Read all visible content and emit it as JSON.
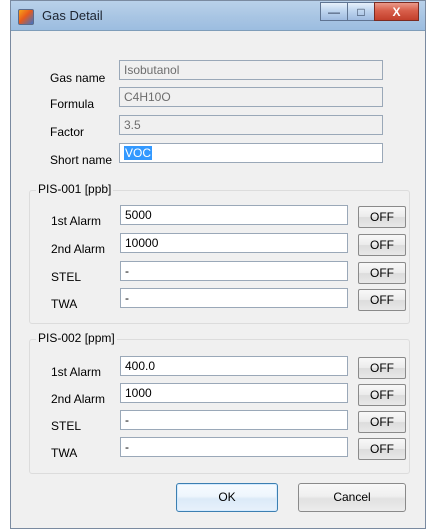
{
  "window": {
    "title": "Gas Detail",
    "background_glyph": "g"
  },
  "fields": {
    "gas_name": {
      "label": "Gas name",
      "value": "Isobutanol"
    },
    "formula": {
      "label": "Formula",
      "value": "C4H10O"
    },
    "factor": {
      "label": "Factor",
      "value": "3.5"
    },
    "short_name": {
      "label": "Short name",
      "value": "VOC"
    }
  },
  "groups": [
    {
      "title": "PIS-001  [ppb]",
      "rows": [
        {
          "label": "1st Alarm",
          "value": "5000",
          "button": "OFF"
        },
        {
          "label": "2nd Alarm",
          "value": "10000",
          "button": "OFF"
        },
        {
          "label": "STEL",
          "value": "-",
          "button": "OFF"
        },
        {
          "label": "TWA",
          "value": "-",
          "button": "OFF"
        }
      ]
    },
    {
      "title": "PIS-002  [ppm]",
      "rows": [
        {
          "label": "1st Alarm",
          "value": "400.0",
          "button": "OFF"
        },
        {
          "label": "2nd Alarm",
          "value": "1000",
          "button": "OFF"
        },
        {
          "label": "STEL",
          "value": "-",
          "button": "OFF"
        },
        {
          "label": "TWA",
          "value": "-",
          "button": "OFF"
        }
      ]
    }
  ],
  "buttons": {
    "ok": "OK",
    "cancel": "Cancel"
  },
  "window_controls": {
    "minimize": "—",
    "maximize": "□",
    "close": "X"
  },
  "colors": {
    "title_bar": "#a8c5e3",
    "dialog_background": "#f0f0f0",
    "selection": "#3399ff",
    "ok_button_border": "#3c7fb1",
    "close_button": "#d85f4b"
  },
  "icons": {
    "app_icon": "app-window-icon",
    "minimize": "minimize-icon",
    "maximize": "maximize-icon",
    "close": "close-icon"
  }
}
